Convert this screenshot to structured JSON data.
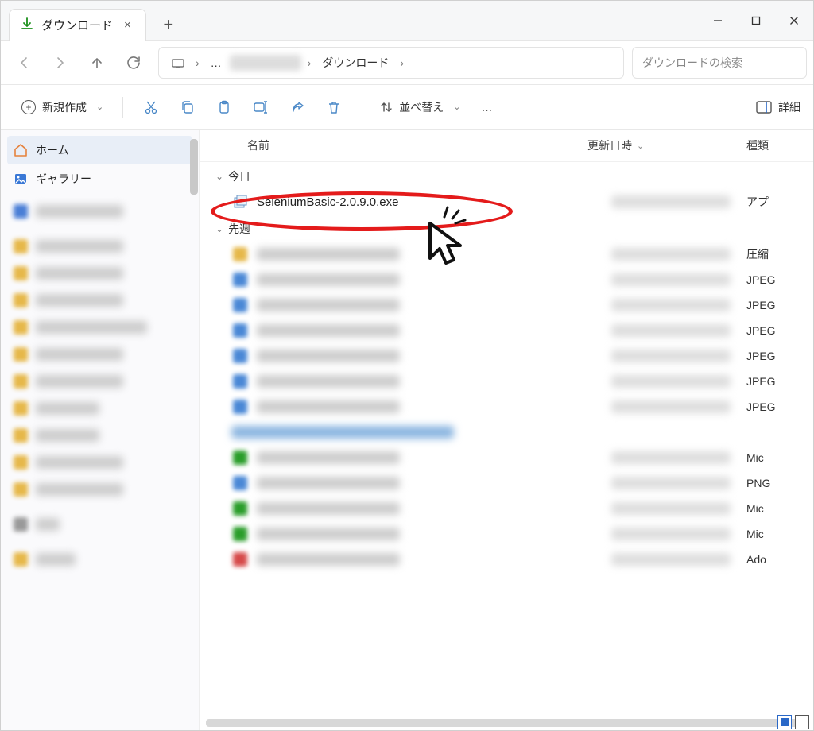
{
  "titlebar": {
    "tab_title": "ダウンロード",
    "tab_close": "×",
    "new_tab": "+"
  },
  "nav": {
    "breadcrumb_ellipsis": "…",
    "breadcrumb_current": "ダウンロード",
    "search_placeholder": "ダウンロードの検索"
  },
  "toolbar": {
    "new_label": "新規作成",
    "sort_label": "並べ替え",
    "more": "…",
    "detail_label": "詳細"
  },
  "sidebar": {
    "home": "ホーム",
    "gallery": "ギャラリー"
  },
  "columns": {
    "name": "名前",
    "modified": "更新日時",
    "type": "種類"
  },
  "groups": {
    "today": "今日",
    "last_week": "先週"
  },
  "files": {
    "highlighted": {
      "name": "SeleniumBasic-2.0.9.0.exe",
      "type": "アプ"
    },
    "blurred": [
      {
        "icon": "yellow",
        "type": "圧縮"
      },
      {
        "icon": "blue",
        "type": "JPEG"
      },
      {
        "icon": "blue",
        "type": "JPEG"
      },
      {
        "icon": "blue",
        "type": "JPEG"
      },
      {
        "icon": "blue",
        "type": "JPEG"
      },
      {
        "icon": "blue",
        "type": "JPEG"
      },
      {
        "icon": "blue",
        "type": "JPEG"
      }
    ],
    "blurred2": [
      {
        "icon": "green",
        "type": "Mic"
      },
      {
        "icon": "blue",
        "type": "PNG"
      },
      {
        "icon": "green",
        "type": "Mic"
      },
      {
        "icon": "green",
        "type": "Mic"
      },
      {
        "icon": "red",
        "type": "Ado"
      }
    ]
  }
}
